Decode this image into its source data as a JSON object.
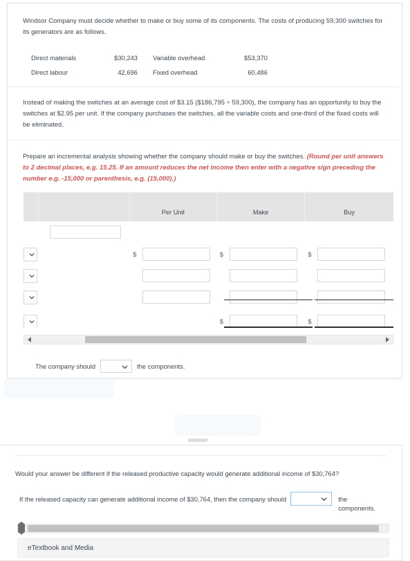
{
  "problem": {
    "intro": "Windsor Company must decide whether to make or buy some of its components. The costs of producing 59,300 switches for its generators are as follows.",
    "costs": [
      {
        "label1": "Direct materials",
        "value1": "$30,243",
        "label2": "Variable overhead",
        "value2": "$53,370"
      },
      {
        "label1": "Direct labour",
        "value1": "42,696",
        "label2": "Fixed overhead",
        "value2": "60,486"
      }
    ],
    "alternative": "Instead of making the switches at an average cost of $3.15 ($186,795 ÷ 59,300), the company has an opportunity to buy the switches at $2.95 per unit. If the company purchases the switches, all the variable costs and one-third of the fixed costs will be eliminated."
  },
  "instruction": {
    "lead": "Prepare an incremental analysis showing whether the company should make or buy the switches. ",
    "emphasis": "(Round per unit answers to 2 decimal places, e.g. 15.25. If an amount reduces the net income then enter with a negative sign preceding the number e.g. -15,000 or parenthesis, e.g. (15,000).)",
    "emphasis_color": "#d9534f"
  },
  "table": {
    "headers": {
      "select": "",
      "name": "",
      "per_unit": "Per Unit",
      "make": "Make",
      "buy": "Buy"
    },
    "title_input": {
      "value": "",
      "placeholder": ""
    },
    "rows": [
      {
        "select_value": "",
        "name": "",
        "per_unit": "",
        "per_unit_prefix": "$",
        "make": "",
        "make_prefix": "$",
        "buy": "",
        "buy_prefix": "$"
      },
      {
        "select_value": "",
        "name": "",
        "per_unit": "",
        "per_unit_prefix": "",
        "make": "",
        "make_prefix": "",
        "buy": "",
        "buy_prefix": ""
      },
      {
        "select_value": "",
        "name": "",
        "per_unit": "",
        "per_unit_prefix": "",
        "make": "",
        "make_prefix": "",
        "buy": "",
        "buy_prefix": ""
      },
      {
        "select_value": "",
        "name": "",
        "per_unit": "",
        "per_unit_prefix": "",
        "make": "",
        "make_prefix": "$",
        "buy": "",
        "buy_prefix": "$"
      }
    ],
    "select_icon": "chevron-down-icon"
  },
  "scrollbar_top": {
    "left_arrow_icon": "scroll-left-arrow-icon",
    "right_arrow_icon": "scroll-right-arrow-icon"
  },
  "conclusion": {
    "prefix": "The company should",
    "select_value": "",
    "suffix": "the components.",
    "select_icon": "chevron-down-icon"
  },
  "bottom": {
    "question": "Would your answer be different if the released productive capacity would generate additional income of $30,764?",
    "answer_prefix": "If the released capacity can generate additional income of $30,764, then the company should",
    "select_value": "",
    "select_icon": "chevron-down-icon",
    "answer_suffix": "the components.",
    "etextbook_label": "eTextbook and Media",
    "scroll_left_icon": "scroll-left-arrow-icon",
    "scroll_right_icon": "scroll-right-arrow-icon"
  }
}
